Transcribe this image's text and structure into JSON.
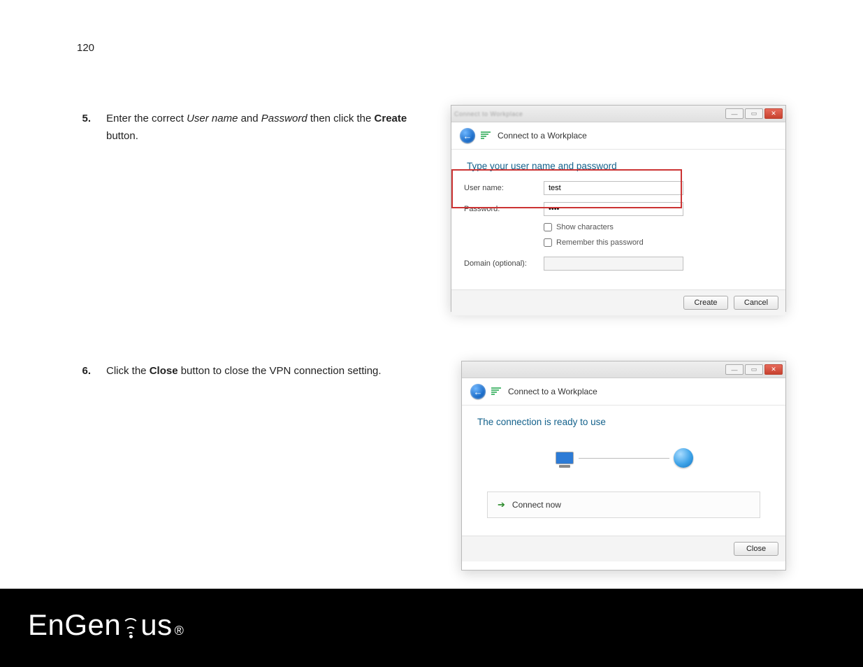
{
  "page_number": "120",
  "steps": {
    "s5": {
      "num": "5.",
      "text_before": "Enter the correct ",
      "em1": "User name",
      "mid": " and ",
      "em2": "Password",
      "after": " then click the ",
      "bold": "Create",
      "tail": " button."
    },
    "s6": {
      "num": "6.",
      "before": "Click the ",
      "bold": "Close",
      "after": " button to close the VPN connection setting."
    }
  },
  "dialog1": {
    "window_title_blur": "Connect to Workplace",
    "header_title": "Connect to a Workplace",
    "heading": "Type your user name and password",
    "labels": {
      "user": "User name:",
      "pass": "Password:",
      "domain": "Domain (optional):"
    },
    "values": {
      "user": "test",
      "pass": "••••",
      "domain": ""
    },
    "checks": {
      "show": "Show characters",
      "remember": "Remember this password"
    },
    "buttons": {
      "create": "Create",
      "cancel": "Cancel"
    },
    "win_ctrl": {
      "min": "—",
      "max": "▭",
      "close": "✕"
    }
  },
  "dialog2": {
    "header_title": "Connect to a Workplace",
    "heading": "The connection is ready to use",
    "connect_now": "Connect now",
    "close": "Close",
    "win_ctrl": {
      "min": "—",
      "max": "▭",
      "close": "✕"
    }
  },
  "brand": {
    "en": "En",
    "g": "Gen",
    "ius": "us",
    "reg": "®"
  }
}
